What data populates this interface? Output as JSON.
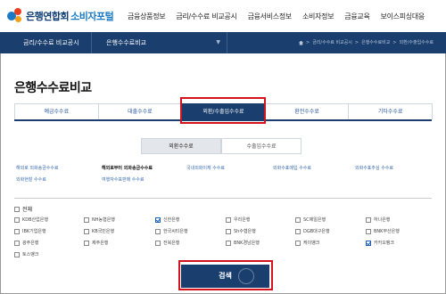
{
  "header": {
    "logo_main": "은행연합회",
    "logo_sub": "소비자포털",
    "menu": [
      "금융상품정보",
      "금리/수수료 비교공시",
      "금융서비스정보",
      "소비자정보",
      "금융교육",
      "보이스피싱대응"
    ]
  },
  "navbar": {
    "menu1": "금리/수수료 비교공시",
    "menu2": "은행수수료비교",
    "breadcrumbs": [
      "금리/수수료 비교공시",
      "은행수수료비교",
      "외환/수출입수수료"
    ]
  },
  "page": {
    "title": "은행수수료비교"
  },
  "tabs": [
    {
      "label": "예금수수료",
      "active": false
    },
    {
      "label": "대출수수료",
      "active": false
    },
    {
      "label": "외환/수출입수수료",
      "active": true
    },
    {
      "label": "환전수수료",
      "active": false
    },
    {
      "label": "기타수수료",
      "active": false
    }
  ],
  "subtabs": [
    {
      "label": "외환수수료",
      "active": true
    },
    {
      "label": "수출입수수료",
      "active": false
    }
  ],
  "categories": [
    "해외로 외화송금수수료",
    "해외로부터 외화송금수수료",
    "국내외화이체 수수료",
    "외화수표매입 수수료",
    "외화수표추심 수수료",
    "외화현찰 수수료",
    "여행자수표판매 수수료"
  ],
  "banks": {
    "all_label": "전체",
    "items": [
      {
        "name": "KDB산업은행",
        "checked": false
      },
      {
        "name": "NH농협은행",
        "checked": false
      },
      {
        "name": "신한은행",
        "checked": true
      },
      {
        "name": "우리은행",
        "checked": false
      },
      {
        "name": "SC제일은행",
        "checked": false
      },
      {
        "name": "하나은행",
        "checked": false
      },
      {
        "name": "IBK기업은행",
        "checked": false
      },
      {
        "name": "KB국민은행",
        "checked": false
      },
      {
        "name": "한국씨티은행",
        "checked": false
      },
      {
        "name": "Sh수협은행",
        "checked": false
      },
      {
        "name": "DGB대구은행",
        "checked": false
      },
      {
        "name": "BNK부산은행",
        "checked": false
      },
      {
        "name": "광주은행",
        "checked": false
      },
      {
        "name": "제주은행",
        "checked": false
      },
      {
        "name": "전북은행",
        "checked": false
      },
      {
        "name": "BNK경남은행",
        "checked": false
      },
      {
        "name": "케이뱅크",
        "checked": false
      },
      {
        "name": "카카오뱅크",
        "checked": true
      },
      {
        "name": "토스뱅크",
        "checked": false
      }
    ]
  },
  "search_button": "검색",
  "colors": {
    "navy": "#1a3e6e",
    "highlight": "#d3141c",
    "link": "#3a6db2"
  }
}
